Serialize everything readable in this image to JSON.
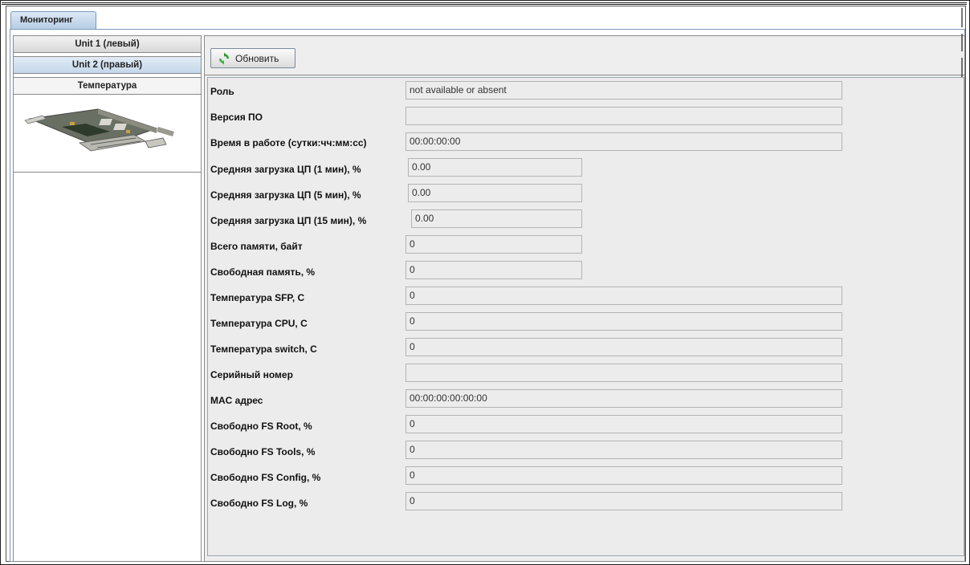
{
  "main_tab": {
    "label": "Мониторинг"
  },
  "side_tabs": [
    {
      "label": "Unit 1 (левый)"
    },
    {
      "label": "Unit 2 (правый)"
    },
    {
      "label": "Температура"
    }
  ],
  "toolbar": {
    "refresh_label": "Обновить"
  },
  "fields": [
    {
      "label": "Роль",
      "value": "not available or absent"
    },
    {
      "label": "Версия ПО",
      "value": ""
    },
    {
      "label": "Время в работе (сутки:чч:мм:сс)",
      "value": "00:00:00:00"
    },
    {
      "label": "Средняя загрузка ЦП (1 мин), %",
      "value": "0.00"
    },
    {
      "label": "Средняя загрузка ЦП (5 мин), %",
      "value": "0.00"
    },
    {
      "label": "Средняя загрузка ЦП (15 мин), %",
      "value": "0.00"
    },
    {
      "label": "Всего памяти, байт",
      "value": "0"
    },
    {
      "label": "Свободная память, %",
      "value": "0"
    },
    {
      "label": "Температура SFP, C",
      "value": "0"
    },
    {
      "label": "Температура CPU, C",
      "value": "0"
    },
    {
      "label": "Температура switch, C",
      "value": "0"
    },
    {
      "label": "Серийный номер",
      "value": ""
    },
    {
      "label": "MAC адрес",
      "value": "00:00:00:00:00:00"
    },
    {
      "label": "Свободно FS Root, %",
      "value": "0"
    },
    {
      "label": "Свободно FS Tools, %",
      "value": "0"
    },
    {
      "label": "Свободно FS Config, %",
      "value": "0"
    },
    {
      "label": "Свободно FS Log, %",
      "value": "0"
    }
  ],
  "colors": {
    "tab_active": "#c4d7ea",
    "panel_bg": "#eeeeee",
    "refresh_icon": "#2f9a2f"
  },
  "icons": {
    "refresh": "refresh-icon",
    "board": "board-image"
  }
}
